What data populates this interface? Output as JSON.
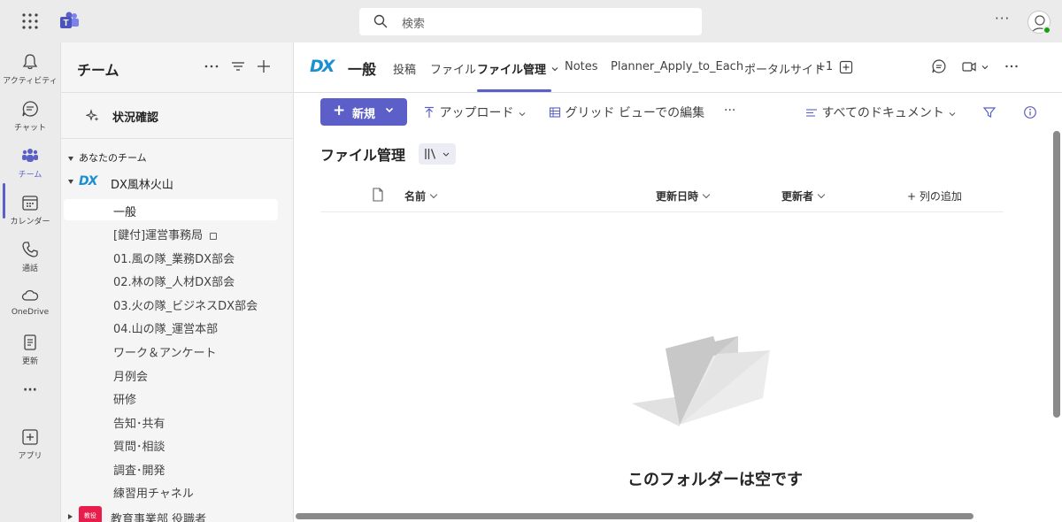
{
  "titlebar": {
    "search_placeholder": "検索",
    "more_label": "···"
  },
  "rail": {
    "items": [
      {
        "label": "アクティビティ",
        "icon": "bell-icon"
      },
      {
        "label": "チャット",
        "icon": "chat-icon"
      },
      {
        "label": "チーム",
        "icon": "teams-icon",
        "active": true
      },
      {
        "label": "カレンダー",
        "icon": "calendar-icon"
      },
      {
        "label": "通話",
        "icon": "phone-icon"
      },
      {
        "label": "OneDrive",
        "icon": "cloud-icon"
      },
      {
        "label": "更新",
        "icon": "updates-icon"
      },
      {
        "label": "···",
        "icon": "more-icon"
      },
      {
        "label": "アプリ",
        "icon": "apps-icon"
      }
    ]
  },
  "pane": {
    "title": "チーム",
    "status_check": "状況確認",
    "section_label": "あなたのチーム",
    "team": {
      "logo_text": "DX",
      "name": "DX風林火山",
      "channels": [
        "一般",
        "[鍵付]運営事務局",
        "01.風の隊_業務DX部会",
        "02.林の隊_人材DX部会",
        "03.火の隊_ビジネスDX部会",
        "04.山の隊_運営本部",
        "ワーク＆アンケート",
        "月例会",
        "研修",
        "告知･共有",
        "質問･相談",
        "調査･開発",
        "練習用チャネル"
      ]
    },
    "team2": {
      "badge": "教役",
      "name": "教育事業部 役職者"
    }
  },
  "channel_header": {
    "logo_text": "DX",
    "channel_name": "一般",
    "tabs": [
      "投稿",
      "ファイル",
      "ファイル管理",
      "Notes",
      "Planner_Apply_to_Each",
      "ポータルサイト",
      "+1"
    ],
    "active_tab": "ファイル管理"
  },
  "toolbar": {
    "new_label": "新規",
    "upload_label": "アップロード",
    "grid_edit_label": "グリッド ビューでの編集",
    "more_label": "···",
    "view_label": "すべてのドキュメント"
  },
  "library": {
    "title": "ファイル管理",
    "columns": {
      "name": "名前",
      "modified": "更新日時",
      "modified_by": "更新者",
      "add_column": "+ 列の追加"
    },
    "empty_message": "このフォルダーは空です"
  },
  "colors": {
    "accent": "#5b5fc7",
    "dx_blue": "#1a8fd3",
    "presence": "#13a10e",
    "team2_badge": "#e81d4b"
  }
}
